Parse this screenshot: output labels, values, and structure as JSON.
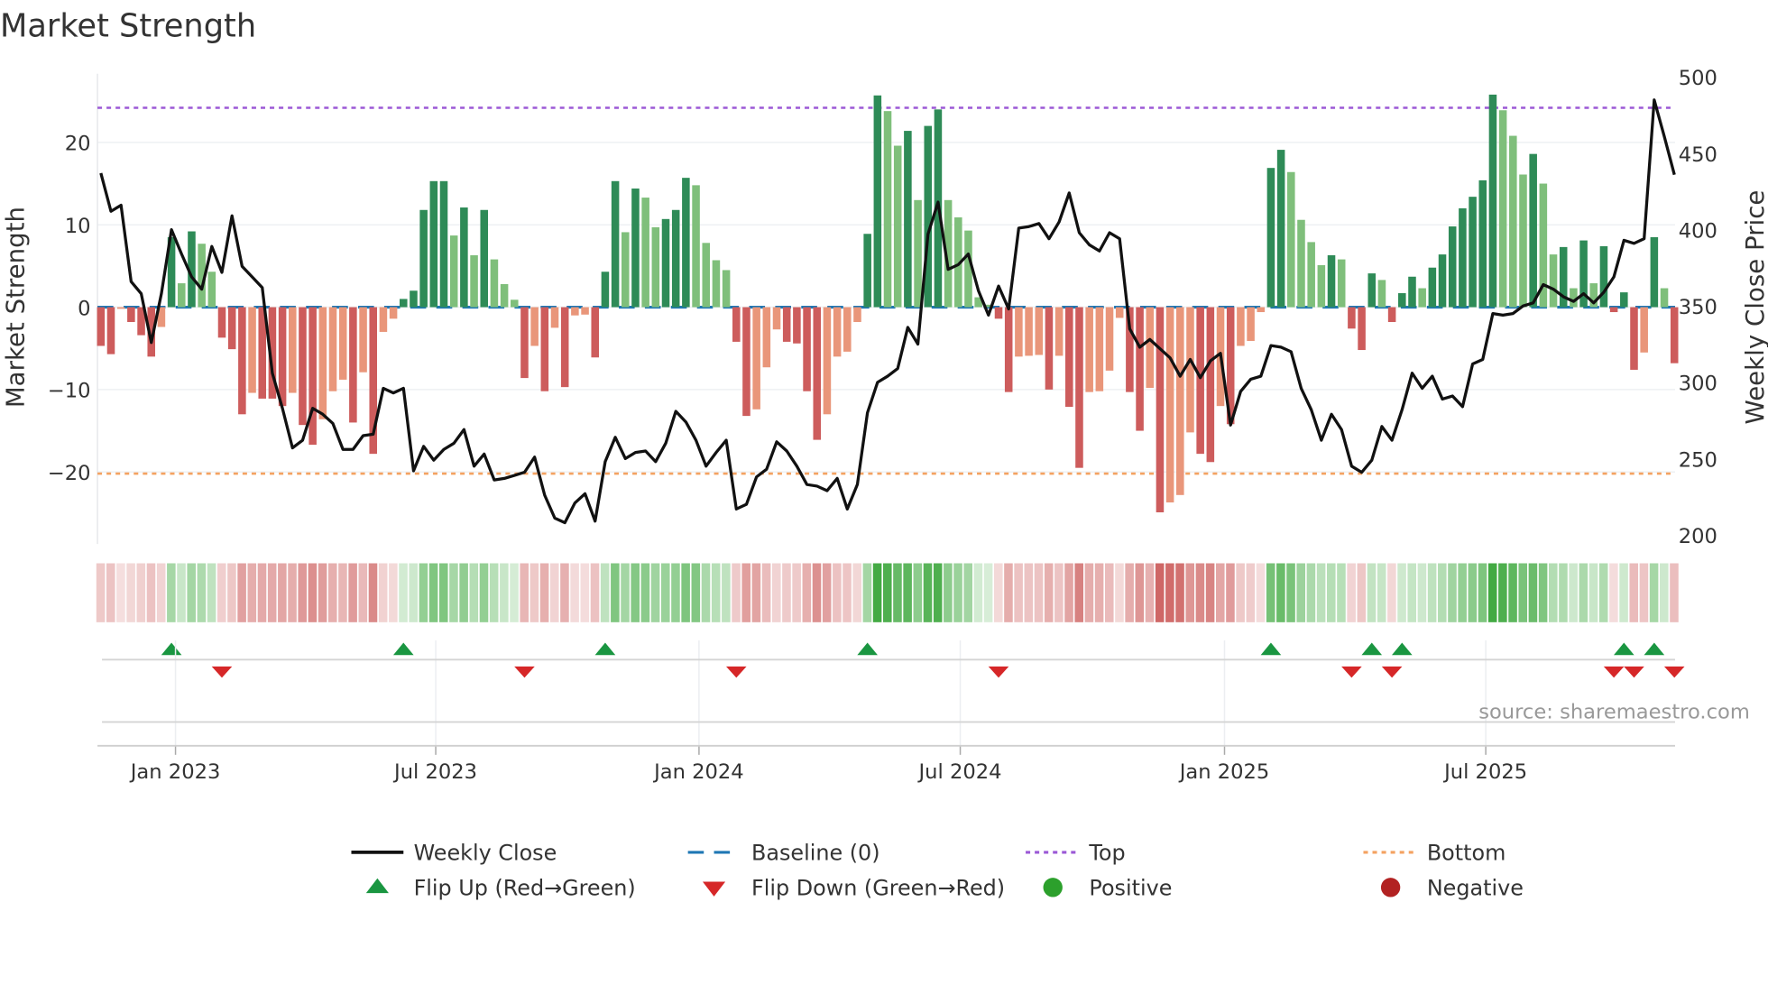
{
  "chart_data": {
    "type": "bar",
    "title": "Market Strength",
    "ylabel": "Market Strength",
    "y2label": "Weekly Close Price",
    "ylim": [
      -28,
      28
    ],
    "y2lim": [
      200,
      510
    ],
    "yticks": [
      20,
      10,
      0,
      -10,
      -20
    ],
    "ytick_labels": [
      "20",
      "10",
      "0",
      "−10",
      "−20"
    ],
    "y2ticks": [
      500,
      450,
      400,
      350,
      300,
      250,
      200
    ],
    "y2tick_labels": [
      "500",
      "450",
      "400",
      "350",
      "300",
      "250",
      "200"
    ],
    "x_interval": "weekly",
    "xtick_labels": [
      "Jan 2023",
      "Jul 2023",
      "Jan 2024",
      "Jul 2024",
      "Jan 2025",
      "Jul 2025"
    ],
    "xtick_week_index": [
      7.4,
      33.2,
      59.3,
      85.2,
      111.4,
      137.3
    ],
    "top_level": 24.2,
    "bottom_level": -20.2,
    "baseline": 0,
    "strength": [
      -4.7,
      -5.7,
      -0.2,
      -1.8,
      -3.4,
      -6.0,
      -2.4,
      8.5,
      2.9,
      9.2,
      7.7,
      4.3,
      -3.7,
      -5.1,
      -13.0,
      -10.4,
      -11.1,
      -11.1,
      -12.0,
      -10.4,
      -14.3,
      -16.7,
      -13.6,
      -10.2,
      -8.8,
      -14.0,
      -7.9,
      -17.8,
      -3.0,
      -1.4,
      1.0,
      2.0,
      11.8,
      15.3,
      15.3,
      8.7,
      12.1,
      6.3,
      11.8,
      5.8,
      2.8,
      0.9,
      -8.6,
      -4.7,
      -10.2,
      -2.5,
      -9.7,
      -1.0,
      -0.9,
      -6.1,
      4.3,
      15.3,
      9.1,
      14.4,
      13.3,
      9.7,
      10.7,
      11.8,
      15.7,
      14.8,
      7.8,
      5.7,
      4.5,
      -4.2,
      -13.2,
      -12.4,
      -7.3,
      -2.7,
      -4.2,
      -4.4,
      -10.2,
      -16.1,
      -13.0,
      -6.0,
      -5.4,
      -1.8,
      8.9,
      25.7,
      23.8,
      19.6,
      21.4,
      13.0,
      22.0,
      24.0,
      13.0,
      10.9,
      9.3,
      1.2,
      0.3,
      -1.4,
      -10.3,
      -6.0,
      -5.9,
      -5.8,
      -10.0,
      -5.9,
      -12.1,
      -19.5,
      -10.3,
      -10.2,
      -7.7,
      -1.3,
      -10.3,
      -15.0,
      -9.8,
      -24.9,
      -23.7,
      -22.8,
      -15.2,
      -17.8,
      -18.8,
      -12.0,
      -14.2,
      -4.7,
      -4.1,
      -0.6,
      16.9,
      19.1,
      16.4,
      10.6,
      7.9,
      5.1,
      6.3,
      5.8,
      -2.6,
      -5.2,
      4.1,
      3.3,
      -1.8,
      1.7,
      3.7,
      2.3,
      4.8,
      6.4,
      9.8,
      12.0,
      13.4,
      15.4,
      25.8,
      23.9,
      20.8,
      16.1,
      18.6,
      15.0,
      6.4,
      7.3,
      2.3,
      8.1,
      2.9,
      7.4,
      -0.6,
      1.8,
      -7.6,
      -5.5,
      8.5,
      2.3,
      -6.8
    ],
    "weekly_close": [
      440,
      415,
      419,
      369,
      361,
      329,
      361,
      403,
      387,
      372,
      364,
      392,
      375,
      412,
      379,
      372,
      365,
      309,
      286,
      260,
      265,
      286,
      282,
      276,
      259,
      259,
      268,
      269,
      299,
      296,
      299,
      245,
      261,
      252,
      259,
      263,
      272,
      248,
      256,
      239,
      240,
      242,
      244,
      254,
      229,
      214,
      211,
      224,
      230,
      212,
      251,
      267,
      253,
      257,
      258,
      251,
      263,
      284,
      277,
      265,
      248,
      257,
      265,
      220,
      223,
      241,
      246,
      264,
      258,
      248,
      236,
      235,
      232,
      240,
      220,
      236,
      283,
      303,
      307,
      312,
      339,
      328,
      400,
      421,
      377,
      380,
      387,
      363,
      347,
      366,
      351,
      404,
      405,
      407,
      397,
      408,
      427,
      401,
      393,
      389,
      401,
      397,
      338,
      326,
      331,
      325,
      319,
      307,
      318,
      306,
      317,
      322,
      275,
      297,
      305,
      307,
      327,
      326,
      323,
      299,
      285,
      265,
      282,
      272,
      248,
      244,
      252,
      274,
      265,
      285,
      309,
      299,
      307,
      292,
      294,
      287,
      315,
      318,
      348,
      347,
      348,
      353,
      355,
      367,
      364,
      359,
      356,
      361,
      355,
      362,
      372,
      396,
      394,
      397,
      488,
      464,
      439
    ],
    "flip_up_week_index": [
      7,
      30,
      50,
      76,
      116,
      126,
      129,
      151,
      154
    ],
    "flip_down_week_index": [
      12,
      42,
      63,
      89,
      124,
      128,
      150,
      152,
      156
    ],
    "legend": {
      "placement": "bottom",
      "items": [
        "Weekly Close",
        "Baseline (0)",
        "Top",
        "Bottom",
        "Flip Up (Red→Green)",
        "Flip Down (Green→Red)",
        "Positive",
        "Negative"
      ]
    },
    "source": "source: sharemaestro.com",
    "colors": {
      "rising_positive": "#2e8b57",
      "falling_positive": "#7fbf7b",
      "falling_negative": "#cd5c5c",
      "rising_negative": "#e9967a",
      "strip_positive": "#2ca02c",
      "strip_negative": "#c8504f",
      "price_line": "#111111",
      "baseline": "#1f77b4",
      "top": "#9b59d6",
      "bottom": "#f4a261",
      "flip_up": "#1a9641",
      "flip_down": "#d62728",
      "positive_dot": "#2ca02c",
      "negative_dot": "#b22222"
    }
  }
}
